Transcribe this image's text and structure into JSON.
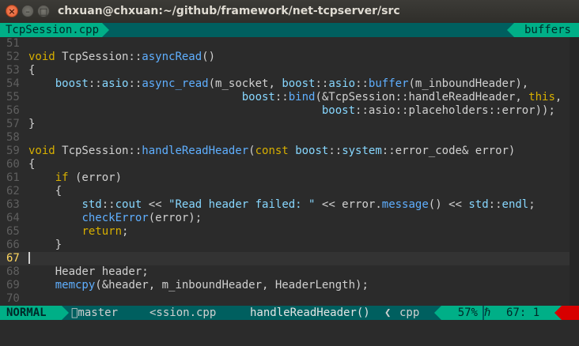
{
  "window": {
    "title": "chxuan@chxuan:~/github/framework/net-tcpserver/src",
    "close_glyph": "×",
    "min_glyph": "–",
    "max_glyph": "□"
  },
  "tabline": {
    "active_tab": "TcpSession.cpp",
    "right_label": "buffers"
  },
  "editor": {
    "current_line": 67,
    "lines": [
      {
        "n": "51",
        "tokens": []
      },
      {
        "n": "52",
        "tokens": [
          [
            "kw",
            "void"
          ],
          [
            "id",
            " TcpSession::"
          ],
          [
            "fn",
            "asyncRead"
          ],
          [
            "op",
            "()"
          ]
        ]
      },
      {
        "n": "53",
        "tokens": [
          [
            "op",
            "{"
          ]
        ]
      },
      {
        "n": "54",
        "tokens": [
          [
            "id",
            "    "
          ],
          [
            "ns",
            "boost"
          ],
          [
            "op",
            "::"
          ],
          [
            "ns",
            "asio"
          ],
          [
            "op",
            "::"
          ],
          [
            "fn",
            "async_read"
          ],
          [
            "op",
            "(m_socket, "
          ],
          [
            "ns",
            "boost"
          ],
          [
            "op",
            "::"
          ],
          [
            "ns",
            "asio"
          ],
          [
            "op",
            "::"
          ],
          [
            "fn",
            "buffer"
          ],
          [
            "op",
            "(m_inboundHeader),"
          ]
        ]
      },
      {
        "n": "55",
        "tokens": [
          [
            "id",
            "                                "
          ],
          [
            "ns",
            "boost"
          ],
          [
            "op",
            "::"
          ],
          [
            "fn",
            "bind"
          ],
          [
            "op",
            "(&TcpSession::handleReadHeader, "
          ],
          [
            "kw",
            "this"
          ],
          [
            "op",
            ","
          ]
        ]
      },
      {
        "n": "56",
        "tokens": [
          [
            "id",
            "                                            "
          ],
          [
            "ns",
            "boost"
          ],
          [
            "op",
            "::asio::placeholders::error));"
          ]
        ]
      },
      {
        "n": "57",
        "tokens": [
          [
            "op",
            "}"
          ]
        ]
      },
      {
        "n": "58",
        "tokens": []
      },
      {
        "n": "59",
        "tokens": [
          [
            "kw",
            "void"
          ],
          [
            "id",
            " TcpSession::"
          ],
          [
            "fn",
            "handleReadHeader"
          ],
          [
            "op",
            "("
          ],
          [
            "kw",
            "const"
          ],
          [
            "id",
            " "
          ],
          [
            "ns",
            "boost"
          ],
          [
            "op",
            "::"
          ],
          [
            "ns",
            "system"
          ],
          [
            "op",
            "::error_code& error)"
          ]
        ]
      },
      {
        "n": "60",
        "tokens": [
          [
            "op",
            "{"
          ]
        ]
      },
      {
        "n": "61",
        "tokens": [
          [
            "id",
            "    "
          ],
          [
            "kw",
            "if"
          ],
          [
            "op",
            " (error)"
          ]
        ]
      },
      {
        "n": "62",
        "tokens": [
          [
            "id",
            "    "
          ],
          [
            "op",
            "{"
          ]
        ]
      },
      {
        "n": "63",
        "tokens": [
          [
            "id",
            "        "
          ],
          [
            "ns",
            "std"
          ],
          [
            "op",
            "::"
          ],
          [
            "ns",
            "cout"
          ],
          [
            "op",
            " << "
          ],
          [
            "str",
            "\"Read header failed: \""
          ],
          [
            "op",
            " << error."
          ],
          [
            "fn",
            "message"
          ],
          [
            "op",
            "() << "
          ],
          [
            "ns",
            "std"
          ],
          [
            "op",
            "::"
          ],
          [
            "ns",
            "endl"
          ],
          [
            "op",
            ";"
          ]
        ]
      },
      {
        "n": "64",
        "tokens": [
          [
            "id",
            "        "
          ],
          [
            "fn",
            "checkError"
          ],
          [
            "op",
            "(error);"
          ]
        ]
      },
      {
        "n": "65",
        "tokens": [
          [
            "id",
            "        "
          ],
          [
            "kw",
            "return"
          ],
          [
            "op",
            ";"
          ]
        ]
      },
      {
        "n": "66",
        "tokens": [
          [
            "id",
            "    "
          ],
          [
            "op",
            "}"
          ]
        ]
      },
      {
        "n": "67",
        "tokens": [],
        "cursor": true
      },
      {
        "n": "68",
        "tokens": [
          [
            "id",
            "    Header header;"
          ]
        ]
      },
      {
        "n": "69",
        "tokens": [
          [
            "id",
            "    "
          ],
          [
            "fn",
            "memcpy"
          ],
          [
            "op",
            "(&header, m_inboundHeader, HeaderLength);"
          ]
        ]
      },
      {
        "n": "70",
        "tokens": []
      }
    ]
  },
  "statusline": {
    "mode": "NORMAL",
    "branch": "master",
    "filename": "<ssion.cpp",
    "function": "handleReadHeader()",
    "separator": "❮",
    "filetype": "cpp",
    "percent": "57%",
    "line_icon": "ℏ",
    "position": "67:  1"
  },
  "colors": {
    "background": "#2b2b2b",
    "accent": "#00af87",
    "dark_teal": "#005f5f",
    "keyword": "#d7af00",
    "function": "#5fafff",
    "namespace": "#87d7ff",
    "warning": "#d70000"
  }
}
